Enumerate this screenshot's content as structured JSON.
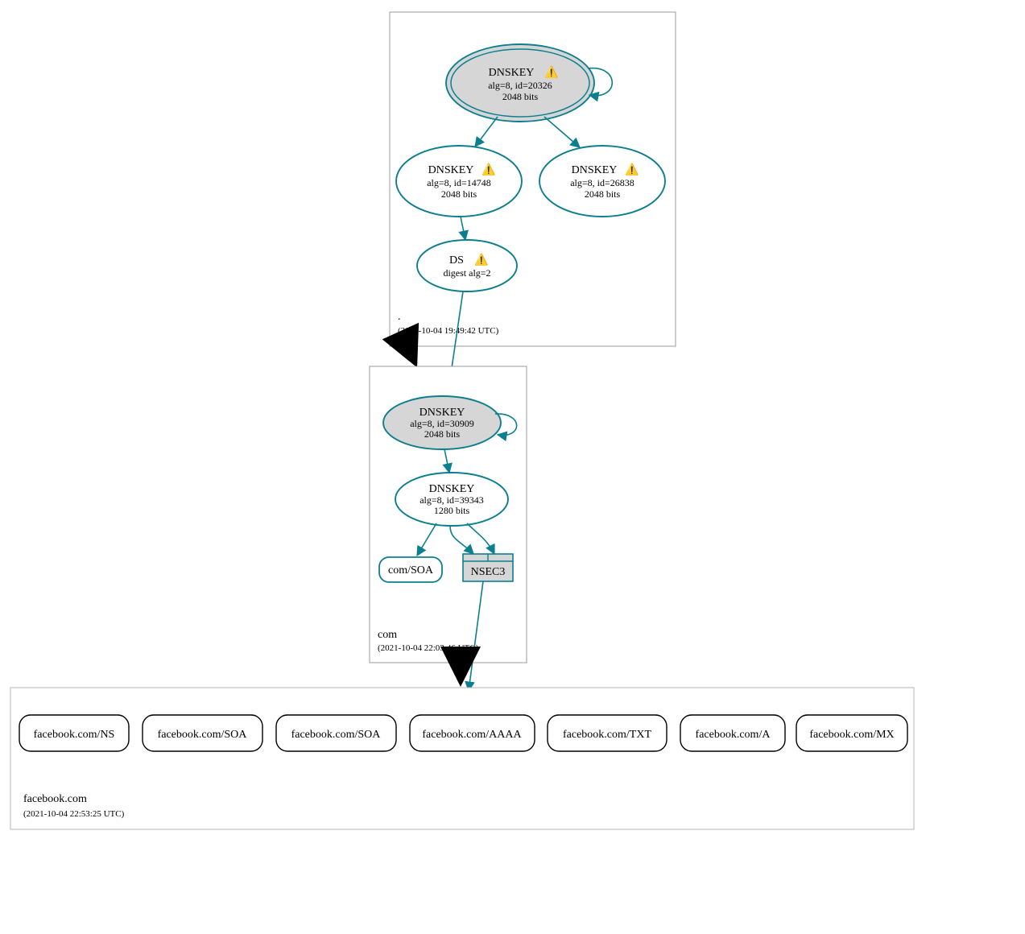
{
  "colors": {
    "accent": "#0c7f8f",
    "node_fill_grey": "#d6d6d6",
    "box_border": "#9b9b9b",
    "black": "#000000",
    "white": "#ffffff"
  },
  "zones": {
    "root": {
      "title": ".",
      "timestamp": "(2021-10-04 19:49:42 UTC)"
    },
    "com": {
      "title": "com",
      "timestamp": "(2021-10-04 22:03:46 UTC)"
    },
    "fb": {
      "title": "facebook.com",
      "timestamp": "(2021-10-04 22:53:25 UTC)"
    }
  },
  "nodes": {
    "root_ksk": {
      "title": "DNSKEY",
      "line2": "alg=8, id=20326",
      "line3": "2048 bits",
      "warn": true
    },
    "root_zsk1": {
      "title": "DNSKEY",
      "line2": "alg=8, id=14748",
      "line3": "2048 bits",
      "warn": true
    },
    "root_zsk2": {
      "title": "DNSKEY",
      "line2": "alg=8, id=26838",
      "line3": "2048 bits",
      "warn": true
    },
    "root_ds": {
      "title": "DS",
      "line2": "digest alg=2",
      "warn": true
    },
    "com_ksk": {
      "title": "DNSKEY",
      "line2": "alg=8, id=30909",
      "line3": "2048 bits"
    },
    "com_zsk": {
      "title": "DNSKEY",
      "line2": "alg=8, id=39343",
      "line3": "1280 bits"
    },
    "com_soa": {
      "title": "com/SOA"
    },
    "com_nsec3": {
      "title": "NSEC3"
    }
  },
  "rrsets": {
    "r0": "facebook.com/NS",
    "r1": "facebook.com/SOA",
    "r2": "facebook.com/SOA",
    "r3": "facebook.com/AAAA",
    "r4": "facebook.com/TXT",
    "r5": "facebook.com/A",
    "r6": "facebook.com/MX"
  },
  "warn_glyph": "⚠️"
}
